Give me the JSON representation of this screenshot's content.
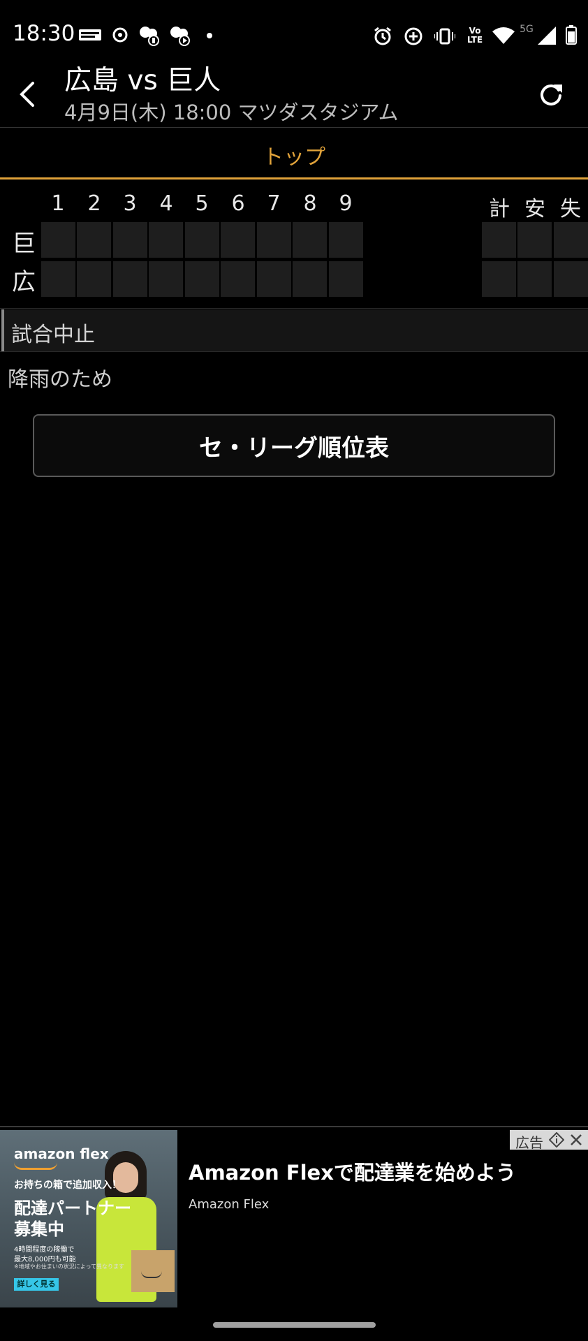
{
  "status_bar": {
    "time": "18:30",
    "left_icons": [
      "sportsnavi-icon",
      "timer-icon",
      "game-app-icon",
      "play-app-icon",
      "dot-icon"
    ],
    "right_icons": [
      "alarm-icon",
      "data-saver-icon",
      "vibrate-icon",
      "volte-icon",
      "wifi-icon",
      "signal-icon",
      "battery-icon"
    ],
    "network_label": "5G",
    "volte_label": "Vo LTE"
  },
  "header": {
    "title": "広島 vs 巨人",
    "subtitle": "4月9日(木) 18:00 マツダスタジアム",
    "back_icon": "back-arrow-icon",
    "refresh_icon": "refresh-icon"
  },
  "tabs": [
    {
      "label": "トップ",
      "active": true
    }
  ],
  "accent_color": "#e0a23a",
  "scoreboard": {
    "innings": [
      "1",
      "2",
      "3",
      "4",
      "5",
      "6",
      "7",
      "8",
      "9"
    ],
    "stat_headers": [
      "計",
      "安",
      "失"
    ],
    "teams": [
      {
        "label": "巨",
        "scores": [
          "",
          "",
          "",
          "",
          "",
          "",
          "",
          "",
          ""
        ],
        "stats": [
          "",
          "",
          ""
        ]
      },
      {
        "label": "広",
        "scores": [
          "",
          "",
          "",
          "",
          "",
          "",
          "",
          "",
          ""
        ],
        "stats": [
          "",
          "",
          ""
        ]
      }
    ]
  },
  "game_status": "試合中止",
  "reason": "降雨のため",
  "standings_button": "セ・リーグ順位表",
  "ad": {
    "title": "Amazon Flexで配達業を始めよう",
    "advertiser": "Amazon Flex",
    "badge_label": "広告",
    "image": {
      "brand": "amazon flex",
      "line1": "お持ちの箱で追加収入！",
      "headline1": "配達パートナー",
      "headline2": "募集中",
      "small1": "4時間程度の稼働で",
      "small2": "最大8,000円も可能",
      "small3": "※地域やお住まいの状況によって異なります",
      "cta": "詳しく見る"
    }
  }
}
